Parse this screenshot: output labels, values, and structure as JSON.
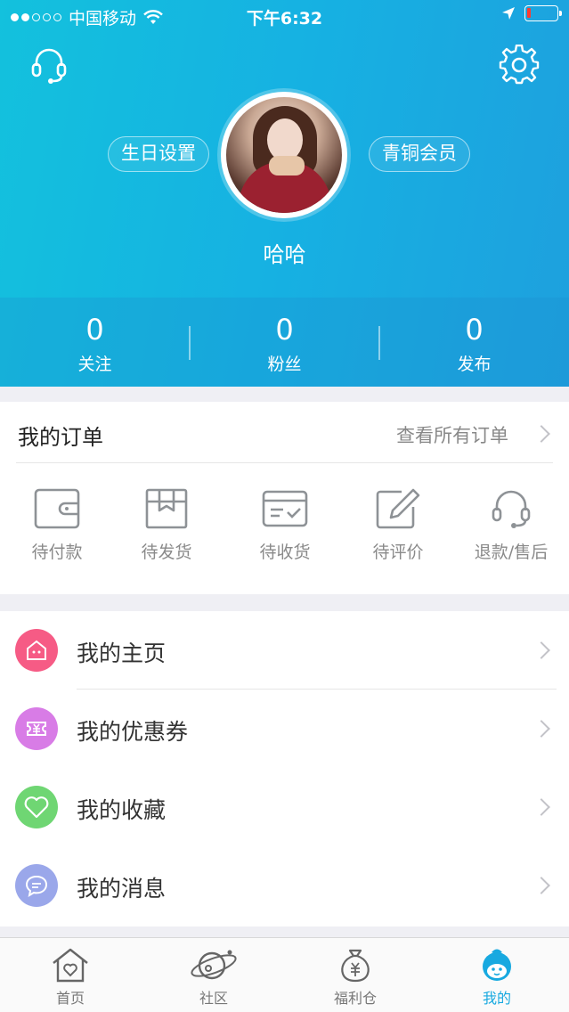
{
  "status_bar": {
    "carrier": "中国移动",
    "time": "下午6:32"
  },
  "header": {
    "birthday_label": "生日设置",
    "member_label": "青铜会员",
    "username": "哈哈",
    "stats": [
      {
        "value": "0",
        "label": "关注"
      },
      {
        "value": "0",
        "label": "粉丝"
      },
      {
        "value": "0",
        "label": "发布"
      }
    ]
  },
  "orders": {
    "title": "我的订单",
    "view_all": "查看所有订单",
    "items": [
      {
        "label": "待付款",
        "icon": "wallet-icon"
      },
      {
        "label": "待发货",
        "icon": "package-icon"
      },
      {
        "label": "待收货",
        "icon": "card-check-icon"
      },
      {
        "label": "待评价",
        "icon": "edit-icon"
      },
      {
        "label": "退款/售后",
        "icon": "headset-icon"
      }
    ]
  },
  "menu": {
    "items": [
      {
        "label": "我的主页",
        "icon": "home-icon",
        "color": "#f65b85"
      },
      {
        "label": "我的优惠券",
        "icon": "coupon-icon",
        "color": "#d87ce6"
      },
      {
        "label": "我的收藏",
        "icon": "heart-icon",
        "color": "#6fd673"
      },
      {
        "label": "我的消息",
        "icon": "message-icon",
        "color": "#9aa7ea"
      }
    ]
  },
  "tabbar": {
    "items": [
      {
        "label": "首页",
        "icon": "home-tab-icon"
      },
      {
        "label": "社区",
        "icon": "planet-icon"
      },
      {
        "label": "福利仓",
        "icon": "money-bag-icon"
      },
      {
        "label": "我的",
        "icon": "profile-icon",
        "active": true
      }
    ]
  },
  "colors": {
    "header_start": "#13c1dd",
    "header_end": "#1ea0de",
    "accent": "#18a9e0",
    "battery_low": "#ff3b30"
  }
}
